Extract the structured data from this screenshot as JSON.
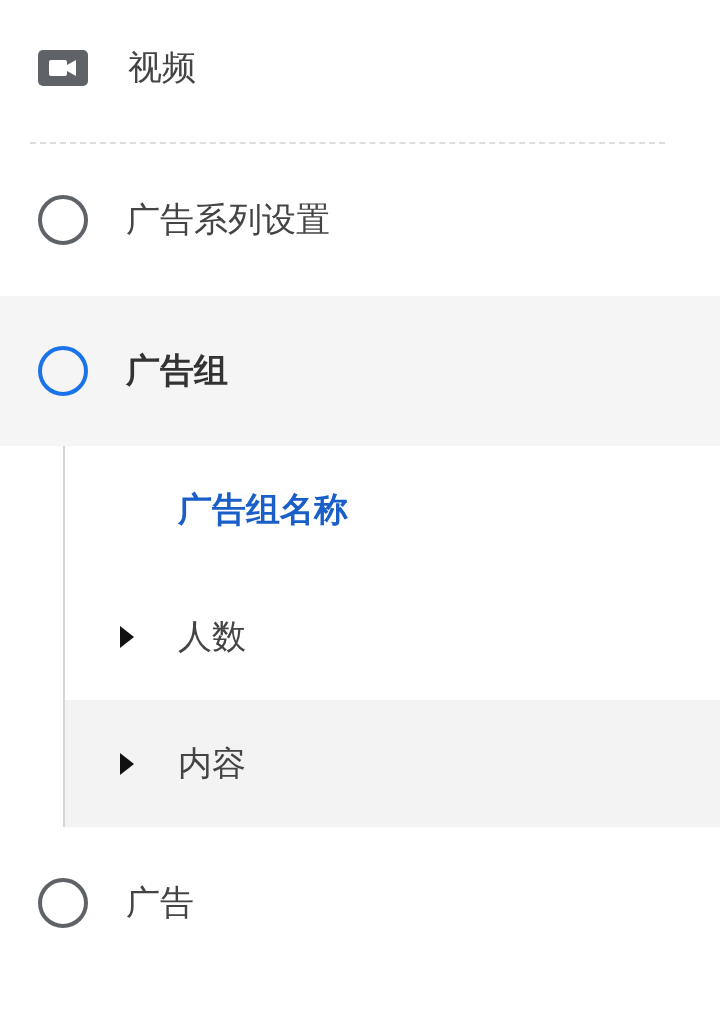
{
  "header": {
    "label": "视频"
  },
  "steps": [
    {
      "label": "广告系列设置",
      "selected": false
    },
    {
      "label": "广告组",
      "selected": true,
      "children": [
        {
          "kind": "field",
          "label": "广告组名称",
          "selected": true,
          "highlighted": false
        },
        {
          "kind": "section",
          "label": "人数",
          "selected": false,
          "highlighted": false
        },
        {
          "kind": "section",
          "label": "内容",
          "selected": false,
          "highlighted": true
        }
      ]
    },
    {
      "label": "广告",
      "selected": false
    }
  ]
}
